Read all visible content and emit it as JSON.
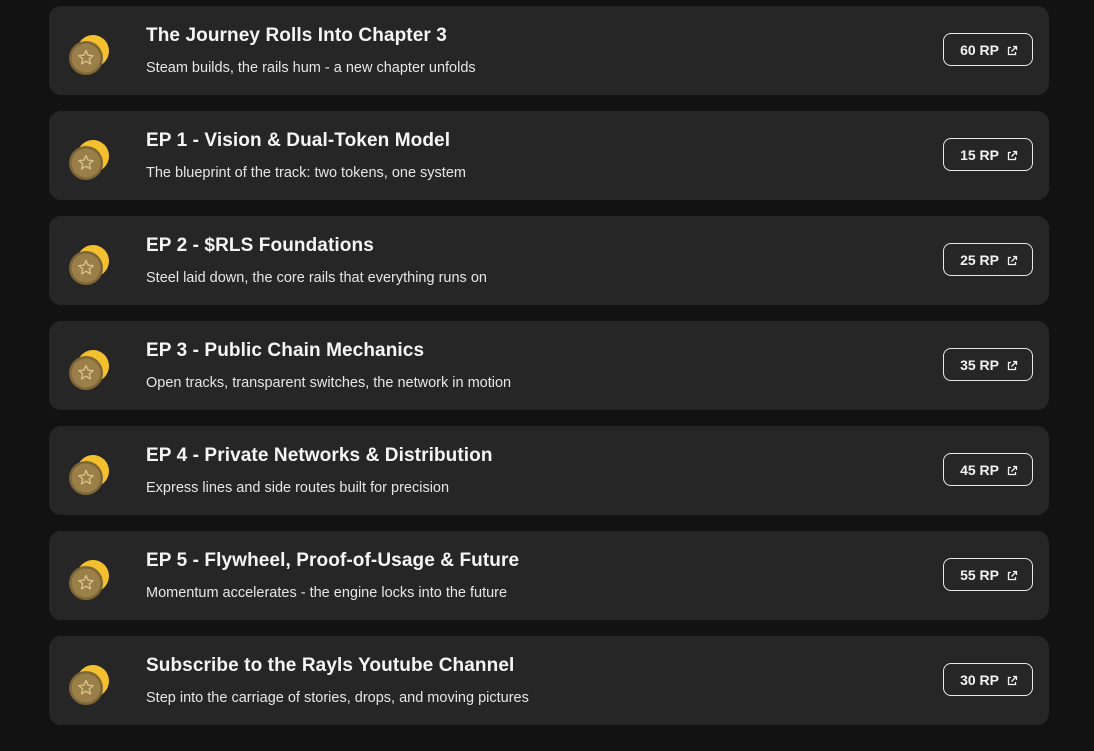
{
  "items": [
    {
      "title": "The Journey Rolls Into Chapter 3",
      "subtitle": "Steam builds, the rails hum - a new chapter unfolds",
      "points": "60 RP",
      "icon": "star-coin-icon",
      "action_icon": "external-link-icon"
    },
    {
      "title": "EP 1 - Vision & Dual-Token Model",
      "subtitle": "The blueprint of the track: two tokens, one system",
      "points": "15 RP",
      "icon": "star-coin-icon",
      "action_icon": "external-link-icon"
    },
    {
      "title": "EP 2 - $RLS Foundations",
      "subtitle": "Steel laid down, the core rails that everything runs on",
      "points": "25 RP",
      "icon": "star-coin-icon",
      "action_icon": "external-link-icon"
    },
    {
      "title": "EP 3 - Public Chain Mechanics",
      "subtitle": "Open tracks, transparent switches, the network in motion",
      "points": "35 RP",
      "icon": "star-coin-icon",
      "action_icon": "external-link-icon"
    },
    {
      "title": "EP 4 - Private Networks & Distribution",
      "subtitle": "Express lines and side routes built for precision",
      "points": "45 RP",
      "icon": "star-coin-icon",
      "action_icon": "external-link-icon"
    },
    {
      "title": "EP 5 - Flywheel, Proof-of-Usage & Future",
      "subtitle": "Momentum accelerates - the engine locks into the future",
      "points": "55 RP",
      "icon": "star-coin-icon",
      "action_icon": "external-link-icon"
    },
    {
      "title": "Subscribe to the Rayls Youtube Channel",
      "subtitle": "Step into the carriage of stories, drops, and moving pictures",
      "points": "30 RP",
      "icon": "star-coin-icon",
      "action_icon": "external-link-icon"
    }
  ],
  "colors": {
    "page_background": "#121212",
    "card_background": "#262626",
    "coin_gold": "#f4c02e",
    "coin_bronze": "#8a7140",
    "text": "#f5f5f5"
  }
}
